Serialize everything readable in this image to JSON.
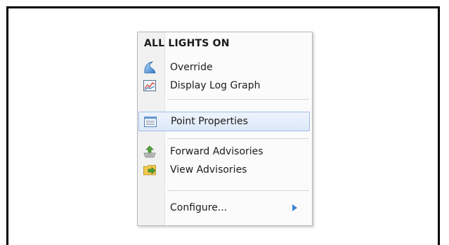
{
  "menu": {
    "title": "ALL LIGHTS ON",
    "items": [
      {
        "label": "Override",
        "icon": "override-icon"
      },
      {
        "label": "Display Log Graph",
        "icon": "log-graph-icon"
      },
      {
        "label": "Point Properties",
        "icon": "point-properties-icon",
        "highlighted": true
      },
      {
        "label": "Forward Advisories",
        "icon": "forward-advisories-icon"
      },
      {
        "label": "View Advisories",
        "icon": "view-advisories-icon"
      },
      {
        "label": "Configure...",
        "has_submenu": true
      }
    ]
  },
  "colors": {
    "highlight": "#dce8f8",
    "highlight_border": "#9fbde7",
    "submenu_arrow": "#3f84d2"
  }
}
